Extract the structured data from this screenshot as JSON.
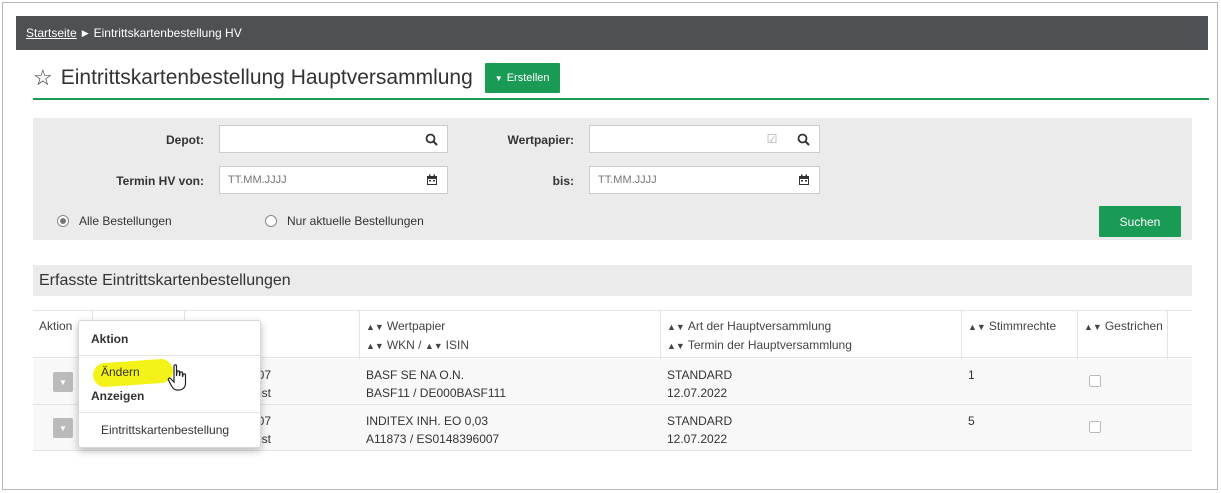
{
  "breadcrumb": {
    "home": "Startseite",
    "current": "Eintrittskartenbestellung HV"
  },
  "page": {
    "title": "Eintrittskartenbestellung Hauptversammlung",
    "create_label": "Erstellen"
  },
  "filter": {
    "depot_label": "Depot:",
    "depot_value": "",
    "wertpapier_label": "Wertpapier:",
    "wertpapier_value": "",
    "termin_von_label": "Termin HV von:",
    "termin_von_placeholder": "TT.MM.JJJJ",
    "bis_label": "bis:",
    "bis_placeholder": "TT.MM.JJJJ",
    "radio_all": "Alle Bestellungen",
    "radio_current": "Nur aktuelle Bestellungen",
    "selected_radio": "Alle Bestellungen",
    "search_label": "Suchen"
  },
  "section_title": "Erfasste Eintrittskartenbestellungen",
  "table": {
    "col_aktion": "Aktion",
    "col_wertpapier": "Wertpapier",
    "col_wkn_isin": "WKN / ↕ ISIN",
    "col_wkn": "WKN /",
    "col_isin": "ISIN",
    "col_art": "Art der Hauptversammlung",
    "col_termin": "Termin der Hauptversammlung",
    "col_stimmrechte": "Stimmrechte",
    "col_gestrichen": "Gestrichen",
    "rows": [
      {
        "depot_line1": "007",
        "depot_line2": "rbst",
        "wertpapier": "BASF SE NA O.N.",
        "wkn_isin": "BASF11 / DE000BASF111",
        "art": "STANDARD",
        "termin": "12.07.2022",
        "stimmrechte": "1"
      },
      {
        "depot_line1": "007",
        "depot_line2": "rbst",
        "wertpapier": "INDITEX INH. EO 0,03",
        "wkn_isin": "A11873 / ES0148396007",
        "art": "STANDARD",
        "termin": "12.07.2022",
        "stimmrechte": "5"
      }
    ]
  },
  "dropdown": {
    "header_aktion": "Aktion",
    "item_aendern": "Ändern",
    "header_anzeigen": "Anzeigen",
    "item_eintrittskarte": "Eintrittskartenbestellung"
  },
  "colors": {
    "accent": "#1a9b55",
    "topbar": "#4d5154",
    "panel": "#ebebeb",
    "highlight": "#f2f200"
  }
}
